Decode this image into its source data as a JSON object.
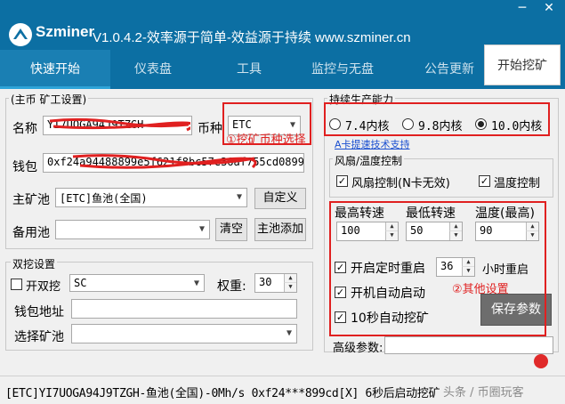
{
  "window": {
    "brand": "Szminer",
    "title": "V1.0.4.2-效率源于简单-效益源于持续 www.szminer.cn",
    "minimize": "─",
    "close": "✕"
  },
  "tabs": [
    "快速开始",
    "仪表盘",
    "工具",
    "监控与无盘",
    "公告更新"
  ],
  "start_button": "开始挖矿",
  "main_settings": {
    "group_title": "(主币 矿工设置)",
    "name_label": "名称",
    "name_value": "YI7UOGA94J9TZGH",
    "coin_label": "币种",
    "coin_value": "ETC",
    "wallet_label": "钱包",
    "wallet_value": "0xf24a94488899e5f621f8bc57e36af755cd0899cd",
    "main_pool_label": "主矿池",
    "main_pool_value": "[ETC]鱼池(全国)",
    "custom_button": "自定义",
    "backup_pool_label": "备用池",
    "backup_pool_value": "",
    "clear_button": "清空",
    "add_pool_button": "主池添加"
  },
  "dual_mining": {
    "group_title": "双挖设置",
    "enable_label": "开双挖",
    "coin_value": "SC",
    "weight_label": "权重:",
    "weight_value": "30",
    "wallet_label": "钱包地址",
    "wallet_value": "",
    "pool_label": "选择矿池",
    "pool_value": ""
  },
  "capacity": {
    "group_title": "持续生产能力",
    "options": [
      "7.4内核",
      "9.8内核",
      "10.0内核"
    ],
    "selected": "10.0内核",
    "link": "A卡提速技术支持"
  },
  "fan": {
    "group_title": "风扇/温度控制",
    "fan_control_label": "风扇控制(N卡无效)",
    "fan_control_checked": true,
    "temp_control_label": "温度控制",
    "temp_control_checked": true,
    "headers": [
      "最高转速",
      "最低转速",
      "温度(最高)"
    ],
    "values": [
      "100",
      "50",
      "90"
    ]
  },
  "other": {
    "timed_restart_label": "开启定时重启",
    "timed_restart_checked": true,
    "restart_hours": "36",
    "hours_label": "小时重启",
    "auto_start_label": "开机自动启动",
    "auto_start_checked": true,
    "auto_mine_label": "10秒自动挖矿",
    "auto_mine_checked": true,
    "save_button": "保存参数",
    "advanced_label": "高级参数:",
    "advanced_value": ""
  },
  "annotations": {
    "coin_note": "①挖矿币种选择",
    "other_note": "②其他设置"
  },
  "status": {
    "text": "[ETC]YI7UOGA94J9TZGH-鱼池(全国)-0Mh/s 0xf24***899cd[X]  6秒后启动挖矿"
  },
  "watermark": "头条 / 币圈玩客",
  "colors": {
    "titlebar": "#0c6fa3",
    "annotation_red": "#e02020",
    "tab_active": "#1a7fb3"
  }
}
